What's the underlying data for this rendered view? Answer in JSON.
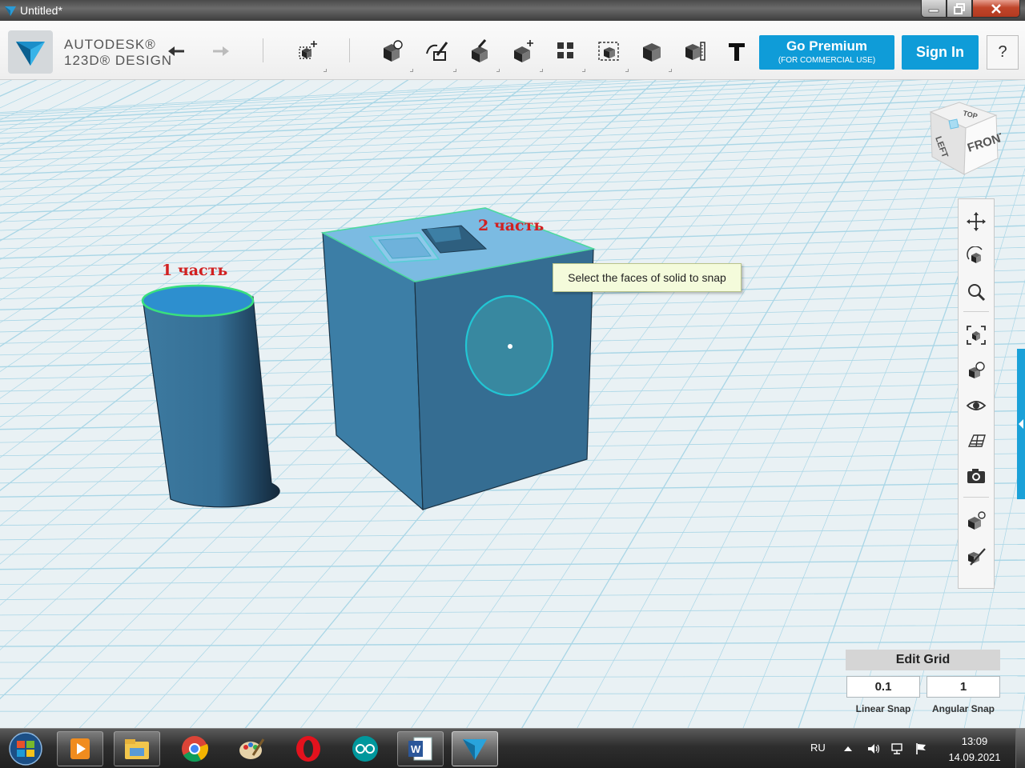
{
  "window": {
    "title": "Untitled*"
  },
  "brand": {
    "line1": "AUTODESK®",
    "line2": "123D® DESIGN"
  },
  "toolbar": {
    "tools": [
      {
        "name": "undo-icon"
      },
      {
        "name": "redo-icon"
      },
      {
        "name": "transform-icon"
      },
      {
        "name": "primitives-icon"
      },
      {
        "name": "sketch-icon"
      },
      {
        "name": "construct-icon"
      },
      {
        "name": "modify-icon"
      },
      {
        "name": "pattern-icon"
      },
      {
        "name": "grouping-icon"
      },
      {
        "name": "combine-icon"
      },
      {
        "name": "measure-icon"
      },
      {
        "name": "text-icon"
      }
    ],
    "premium_label": "Go Premium",
    "premium_sub": "(FOR COMMERCIAL USE)",
    "signin_label": "Sign In",
    "help_label": "?"
  },
  "scene": {
    "label1": "1 часть",
    "label2": "2 часть",
    "tooltip": "Select the faces of solid to snap",
    "viewcube": {
      "top": "TOP",
      "left": "LEFT",
      "front": "FRONT"
    }
  },
  "navbar": {
    "items": [
      "pan-icon",
      "orbit-icon",
      "zoom-icon",
      "fit-icon",
      "view-selected-icon",
      "visibility-icon",
      "grid-icon",
      "screenshot-icon",
      "material-icon",
      "snap-icon"
    ]
  },
  "edit_grid": {
    "title": "Edit Grid",
    "linear_value": "0.1",
    "angular_value": "1",
    "linear_label": "Linear Snap",
    "angular_label": "Angular Snap"
  },
  "taskbar": {
    "apps": [
      "media-player-icon",
      "file-explorer-icon",
      "chrome-icon",
      "paint-icon",
      "opera-icon",
      "arduino-icon",
      "word-icon",
      "123d-design-icon"
    ],
    "language": "RU",
    "time": "13:09",
    "date": "14.09.2021"
  },
  "colors": {
    "accent": "#0f9cd8",
    "solid": "#3a7aa0",
    "grid": "#a9d6e6",
    "label_red": "#d12121"
  }
}
